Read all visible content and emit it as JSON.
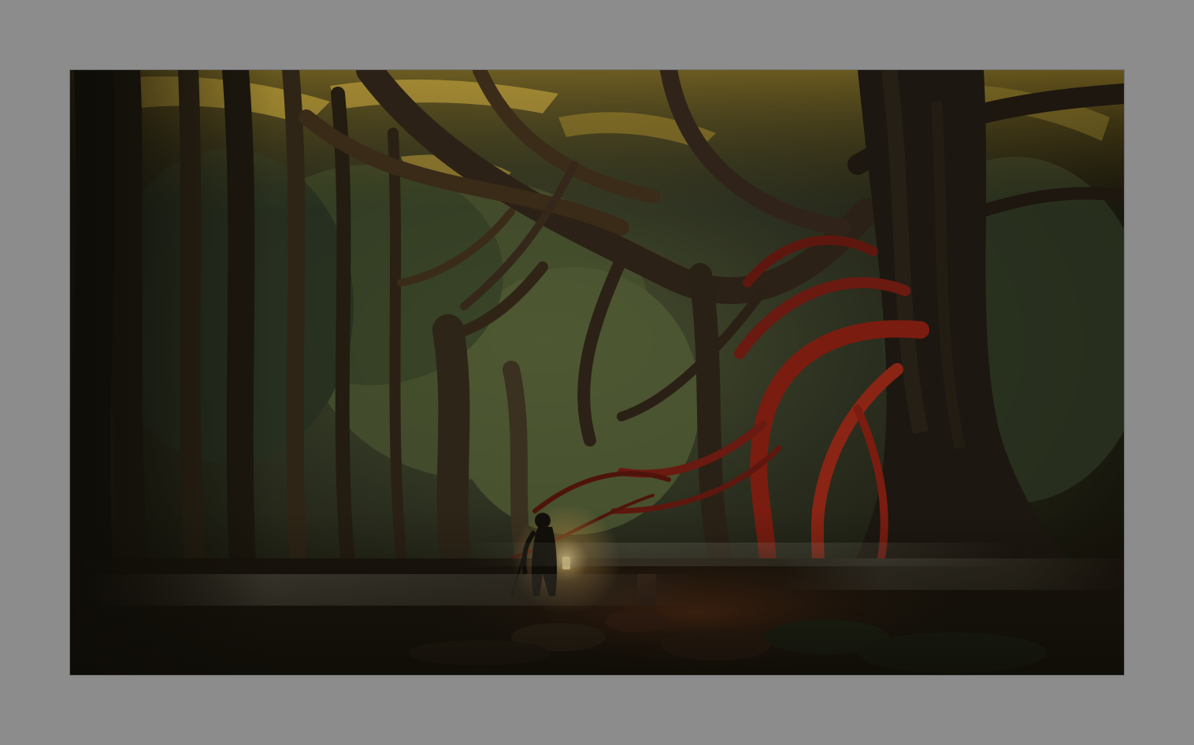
{
  "frame": {
    "background_color": "#8c8c8c"
  },
  "artwork": {
    "subject": "dark-forest-painting",
    "palette": {
      "shadow": "#17140d",
      "canopy_light": "#a88a2c",
      "foliage": "#3e4a2a",
      "mist": "#8a8a74",
      "red_roots": "#7a1c10",
      "trunk": "#2c2116",
      "lantern": "#ffe9a0"
    }
  }
}
